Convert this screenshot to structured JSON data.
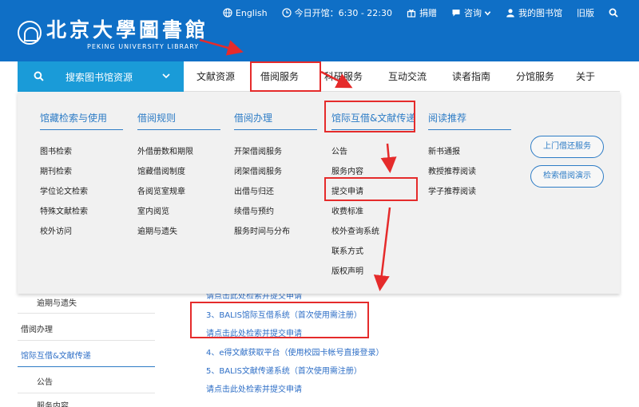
{
  "header": {
    "logo_cn": "北京大學圖書館",
    "logo_en": "PEKING UNIVERSITY LIBRARY",
    "topbar": [
      {
        "icon": "globe-icon",
        "label": "English"
      },
      {
        "icon": "clock-icon",
        "label": "今日开馆：6:30 - 22:30"
      },
      {
        "icon": "gift-icon",
        "label": "捐赠"
      },
      {
        "icon": "chat-icon",
        "label": "咨询"
      },
      {
        "icon": "user-icon",
        "label": "我的图书馆"
      },
      {
        "icon": "",
        "label": "旧版"
      },
      {
        "icon": "search-icon",
        "label": ""
      }
    ]
  },
  "nav": {
    "search_label": "搜索图书馆资源",
    "items": [
      "文献资源",
      "借阅服务",
      "科研服务",
      "互动交流",
      "读者指南",
      "分馆服务",
      "关于"
    ]
  },
  "dropdown": {
    "columns": [
      {
        "heading": "馆藏检索与使用",
        "links": [
          "图书检索",
          "期刊检索",
          "学位论文检索",
          "特殊文献检索",
          "校外访问"
        ]
      },
      {
        "heading": "借阅规则",
        "links": [
          "外借册数和期限",
          "馆藏借阅制度",
          "各阅览室规章",
          "室内阅览",
          "逾期与遗失"
        ]
      },
      {
        "heading": "借阅办理",
        "links": [
          "开架借阅服务",
          "闭架借阅服务",
          "出借与归还",
          "续借与预约",
          "服务时间与分布"
        ]
      },
      {
        "heading": "馆际互借&文献传递",
        "links": [
          "公告",
          "服务内容",
          "提交申请",
          "收费标准",
          "校外查询系统",
          "联系方式",
          "版权声明"
        ]
      },
      {
        "heading": "阅读推荐",
        "links": [
          "新书通报",
          "教授推荐阅读",
          "学子推荐阅读"
        ]
      }
    ],
    "buttons": [
      "上门借还服务",
      "检索借阅演示"
    ]
  },
  "sidebar": {
    "items": [
      "逾期与遗失",
      "借阅办理",
      "馆际互借&文献传递",
      "公告",
      "服务内容"
    ]
  },
  "content": {
    "partial_link": "请点击此处检索并提交申请",
    "entries": [
      {
        "title": "3、BALIS馆际互借系统（首次使用需注册）",
        "link": "请点击此处检索并提交申请"
      },
      {
        "title": "4、e得文献获取平台（使用校园卡帐号直接登录）",
        "link": ""
      },
      {
        "title": "5、BALIS文献传递系统（首次使用需注册）",
        "link": "请点击此处检索并提交申请"
      }
    ]
  },
  "colors": {
    "header_bg": "#0f6fc6",
    "search_bg": "#1a9bd8",
    "accent": "#2d7cc6",
    "annotation": "#e52b2b"
  }
}
